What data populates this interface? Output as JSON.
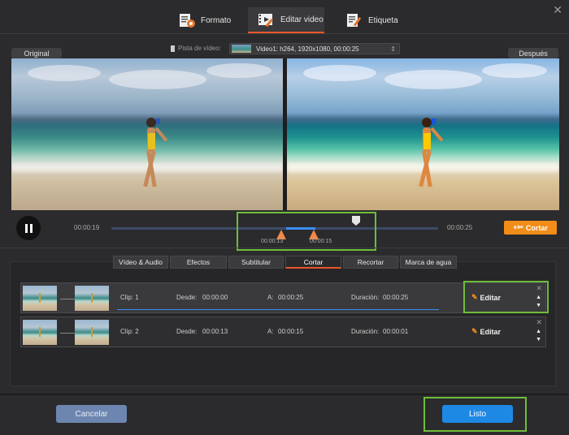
{
  "tabs": [
    {
      "label": "Formato",
      "icon": "format-icon"
    },
    {
      "label": "Editar video",
      "icon": "edit-video-icon",
      "active": true
    },
    {
      "label": "Etiqueta",
      "icon": "tag-icon"
    }
  ],
  "preview": {
    "original_label": "Original",
    "after_label": "Después",
    "track_label": "Pista de vídeo:",
    "track_value": "Video1: h264, 1920x1080, 00:00:25"
  },
  "playback": {
    "time_start": "00:00:19",
    "time_end": "00:00:25",
    "handle_start": "00:00:13",
    "handle_end": "00:00:15",
    "cut_label": "Cortar"
  },
  "edit_tabs": [
    "Vídeo & Audio",
    "Efectos",
    "Subtitular",
    "Cortar",
    "Recortar",
    "Marca de agua"
  ],
  "active_edit_tab": "Cortar",
  "clips": [
    {
      "clip": "Clip: 1",
      "from_label": "Desde:",
      "from": "00:00:00",
      "to_label": "A:",
      "to": "00:00:25",
      "dur_label": "Duración:",
      "dur": "00:00:25",
      "edit": "Editar"
    },
    {
      "clip": "Clip: 2",
      "from_label": "Desde:",
      "from": "00:00:13",
      "to_label": "A:",
      "to": "00:00:15",
      "dur_label": "Duración:",
      "dur": "00:00:01",
      "edit": "Editar"
    }
  ],
  "footer": {
    "cancel": "Cancelar",
    "ok": "Listo"
  },
  "colors": {
    "accent": "#e8562a",
    "cut_button": "#f18d18",
    "ok_button": "#1e88e5",
    "highlight": "#6fbd3a"
  }
}
